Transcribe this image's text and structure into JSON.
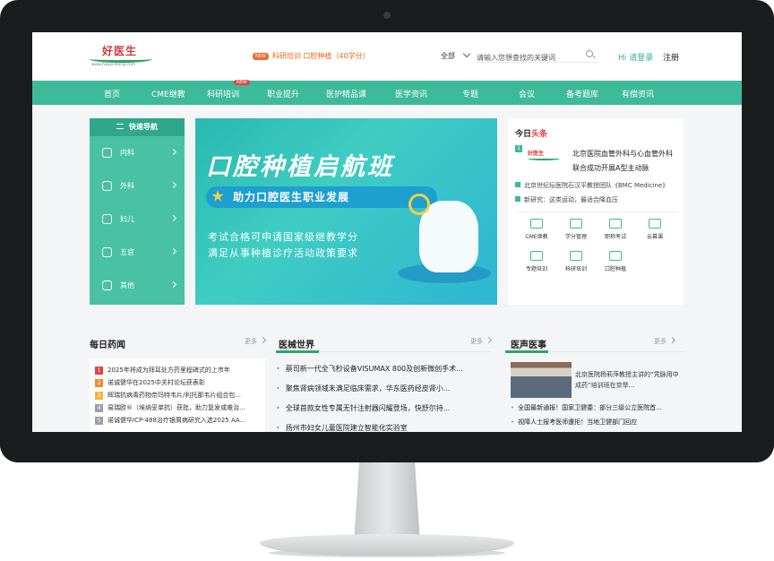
{
  "header": {
    "logo_text": "好医生",
    "logo_url": "www.haoyisheng.com",
    "promo_badge": "NEW",
    "promo_text": "科研培训  口腔种植（40学分）",
    "search_scope": "全部",
    "search_placeholder": "请输入您想查找的关键词",
    "login": "Hi 请登录",
    "register": "注册"
  },
  "nav": {
    "items": [
      "首页",
      "CME继教",
      "科研培训",
      "职业提升",
      "医护精品课",
      "医学资讯",
      "专题",
      "会议",
      "备考题库",
      "有偿资讯"
    ],
    "new_badge": "NEW"
  },
  "quick_nav": {
    "title": "快速导航",
    "items": [
      "内科",
      "外科",
      "妇儿",
      "五官",
      "其他"
    ]
  },
  "banner": {
    "title": "口腔种植启航班",
    "subtitle": "助力口腔医生职业发展",
    "line1": "考试合格可申请国家级继教学分",
    "line2": "满足从事种植诊疗活动政策要求"
  },
  "toutiao": {
    "title_a": "今日",
    "title_b": "头条",
    "headline": "北京医院血管外科与心血管外科联合成功开展A型主动脉",
    "lines": [
      "北京世纪坛医院石汉平教授团队《BMC Medicine》",
      "新研究：这类运动，最适合降血压"
    ],
    "tiles": [
      "CME继教",
      "学分管理",
      "职称考试",
      "云幕课",
      "专题培训",
      "科研培训",
      "口腔种植"
    ]
  },
  "daily_drug": {
    "title": "每日药闻",
    "more": "更多",
    "items": [
      "2025年将成为拜耳处方药里程碑式的上市年",
      "诺诚健华在2025中关村论坛获表彰",
      "辉瑞抗病毒药物奈玛特韦片/利托那韦片组合包...",
      "易瑞欧®（埃纳妥单抗）获批，助力复发或难治...",
      "诺诚健华ICP-488治疗银屑病研究入选2025 AA..."
    ],
    "rank_colors": [
      "#e8413e",
      "#f08a2c",
      "#f4b63a",
      "#9aa0a6",
      "#9aa0a6"
    ]
  },
  "device_world": {
    "title": "医械世界",
    "more": "更多",
    "items": [
      "蔡司新一代全飞秒设备VISUMAX 800及创新微创手术...",
      "聚焦肾病领域未满足临床需求，华东医药经皮肾小...",
      "全球首款女性专属无针注射器闪耀登场，快舒尔持...",
      "扬州市妇女儿童医院建立智能化实验室"
    ]
  },
  "doctor_voice": {
    "title": "医声医事",
    "more": "更多",
    "caption": "北京医院杨莉萍教授主讲的“凭脉用中成药”培训班在京举...",
    "items": [
      "全国最新通报！国家卫健委：部分三级公立医院首...",
      "视障人士报考医师遭拒！当地卫健部门回应"
    ]
  }
}
